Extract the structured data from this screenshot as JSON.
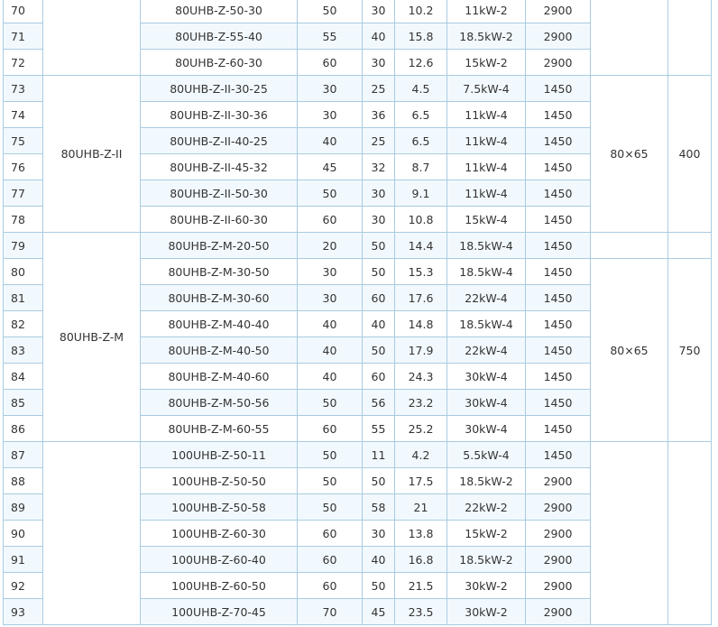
{
  "rows": [
    {
      "no": "70",
      "model": "80UHB-Z-50-30",
      "flow": "50",
      "head": "30",
      "npsh": "10.2",
      "power": "11kW-2",
      "speed": "2900"
    },
    {
      "no": "71",
      "model": "80UHB-Z-55-40",
      "flow": "55",
      "head": "40",
      "npsh": "15.8",
      "power": "18.5kW-2",
      "speed": "2900"
    },
    {
      "no": "72",
      "model": "80UHB-Z-60-30",
      "flow": "60",
      "head": "30",
      "npsh": "12.6",
      "power": "15kW-2",
      "speed": "2900"
    },
    {
      "no": "73",
      "model": "80UHB-Z-II-30-25",
      "flow": "30",
      "head": "25",
      "npsh": "4.5",
      "power": "7.5kW-4",
      "speed": "1450"
    },
    {
      "no": "74",
      "model": "80UHB-Z-II-30-36",
      "flow": "30",
      "head": "36",
      "npsh": "6.5",
      "power": "11kW-4",
      "speed": "1450"
    },
    {
      "no": "75",
      "model": "80UHB-Z-II-40-25",
      "flow": "40",
      "head": "25",
      "npsh": "6.5",
      "power": "11kW-4",
      "speed": "1450"
    },
    {
      "no": "76",
      "model": "80UHB-Z-II-45-32",
      "flow": "45",
      "head": "32",
      "npsh": "8.7",
      "power": "11kW-4",
      "speed": "1450"
    },
    {
      "no": "77",
      "model": "80UHB-Z-II-50-30",
      "flow": "50",
      "head": "30",
      "npsh": "9.1",
      "power": "11kW-4",
      "speed": "1450"
    },
    {
      "no": "78",
      "model": "80UHB-Z-II-60-30",
      "flow": "60",
      "head": "30",
      "npsh": "10.8",
      "power": "15kW-4",
      "speed": "1450"
    },
    {
      "no": "79",
      "model": "80UHB-Z-M-20-50",
      "flow": "20",
      "head": "50",
      "npsh": "14.4",
      "power": "18.5kW-4",
      "speed": "1450"
    },
    {
      "no": "80",
      "model": "80UHB-Z-M-30-50",
      "flow": "30",
      "head": "50",
      "npsh": "15.3",
      "power": "18.5kW-4",
      "speed": "1450"
    },
    {
      "no": "81",
      "model": "80UHB-Z-M-30-60",
      "flow": "30",
      "head": "60",
      "npsh": "17.6",
      "power": "22kW-4",
      "speed": "1450"
    },
    {
      "no": "82",
      "model": "80UHB-Z-M-40-40",
      "flow": "40",
      "head": "40",
      "npsh": "14.8",
      "power": "18.5kW-4",
      "speed": "1450"
    },
    {
      "no": "83",
      "model": "80UHB-Z-M-40-50",
      "flow": "40",
      "head": "50",
      "npsh": "17.9",
      "power": "22kW-4",
      "speed": "1450"
    },
    {
      "no": "84",
      "model": "80UHB-Z-M-40-60",
      "flow": "40",
      "head": "60",
      "npsh": "24.3",
      "power": "30kW-4",
      "speed": "1450"
    },
    {
      "no": "85",
      "model": "80UHB-Z-M-50-56",
      "flow": "50",
      "head": "56",
      "npsh": "23.2",
      "power": "30kW-4",
      "speed": "1450"
    },
    {
      "no": "86",
      "model": "80UHB-Z-M-60-55",
      "flow": "60",
      "head": "55",
      "npsh": "25.2",
      "power": "30kW-4",
      "speed": "1450"
    },
    {
      "no": "87",
      "model": "100UHB-Z-50-11",
      "flow": "50",
      "head": "11",
      "npsh": "4.2",
      "power": "5.5kW-4",
      "speed": "1450"
    },
    {
      "no": "88",
      "model": "100UHB-Z-50-50",
      "flow": "50",
      "head": "50",
      "npsh": "17.5",
      "power": "18.5kW-2",
      "speed": "2900"
    },
    {
      "no": "89",
      "model": "100UHB-Z-50-58",
      "flow": "50",
      "head": "58",
      "npsh": "21",
      "power": "22kW-2",
      "speed": "2900"
    },
    {
      "no": "90",
      "model": "100UHB-Z-60-30",
      "flow": "60",
      "head": "30",
      "npsh": "13.8",
      "power": "15kW-2",
      "speed": "2900"
    },
    {
      "no": "91",
      "model": "100UHB-Z-60-40",
      "flow": "60",
      "head": "40",
      "npsh": "16.8",
      "power": "18.5kW-2",
      "speed": "2900"
    },
    {
      "no": "92",
      "model": "100UHB-Z-60-50",
      "flow": "60",
      "head": "50",
      "npsh": "21.5",
      "power": "30kW-2",
      "speed": "2900"
    },
    {
      "no": "93",
      "model": "100UHB-Z-70-45",
      "flow": "70",
      "head": "45",
      "npsh": "23.5",
      "power": "30kW-2",
      "speed": "2900"
    }
  ],
  "groups": {
    "series_a": {
      "name": ""
    },
    "series_ii": {
      "name": "80UHB-Z-II",
      "size": "80×65",
      "weight": "400"
    },
    "series_m": {
      "name": "80UHB-Z-M",
      "size": "80×65",
      "weight": "750"
    },
    "series_100": {
      "name": ""
    }
  },
  "colors": {
    "border": "#a9cbe1",
    "stripe": "#f2f9fe",
    "text": "#333333"
  }
}
